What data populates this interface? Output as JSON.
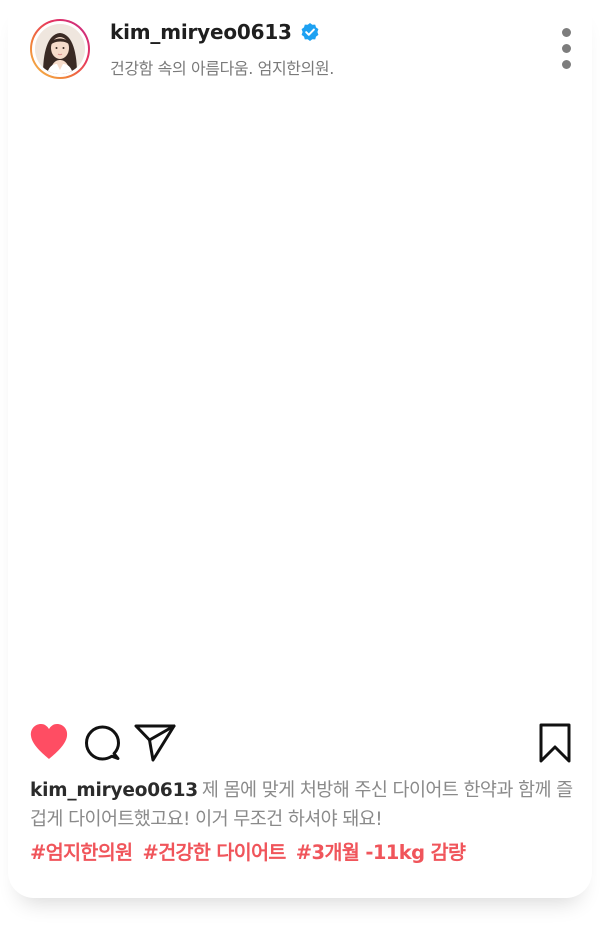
{
  "post": {
    "username": "kim_miryeo0613",
    "verified": true,
    "bio": "건강함 속의 아름다움. 엄지한의원.",
    "caption_user": "kim_miryeo0613",
    "caption_text": "제 몸에 맞게 처방해 주신 다이어트 한약과 함께 즐겁게 다이어트했고요! 이거 무조건 하셔야 돼요!",
    "hashtags": [
      "#엄지한의원",
      "#건강한 다이어트",
      "#3개월 -11kg 감량"
    ]
  },
  "icons": {
    "verified": "verified-badge-icon",
    "more": "more-options-icon",
    "like": "heart-icon",
    "comment": "comment-icon",
    "share": "send-icon",
    "save": "bookmark-icon"
  },
  "colors": {
    "like": "#ff4d63",
    "hashtag": "#f0555b",
    "verified": "#1da1f2",
    "ring_start": "#f6c34a",
    "ring_end": "#c22e8c"
  }
}
